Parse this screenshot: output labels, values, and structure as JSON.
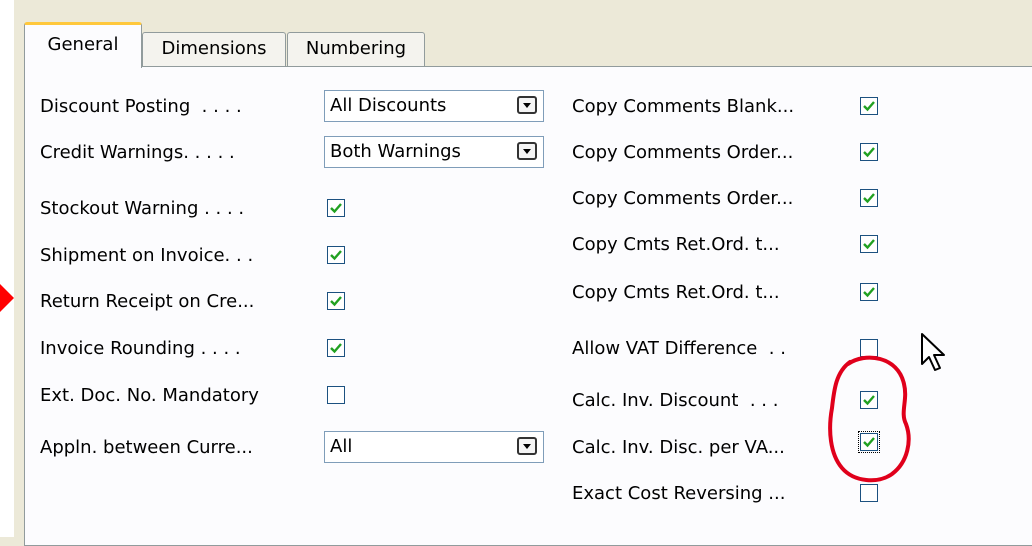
{
  "tabs": [
    "General",
    "Dimensions",
    "Numbering"
  ],
  "left": {
    "discount_posting": {
      "label": "Discount Posting  . . . .",
      "value": "All Discounts"
    },
    "credit_warnings": {
      "label": "Credit Warnings. . . . .",
      "value": "Both Warnings"
    },
    "stockout_warning": {
      "label": "Stockout Warning . . . .",
      "checked": true
    },
    "shipment_on_invoice": {
      "label": "Shipment on Invoice. . .",
      "checked": true
    },
    "return_receipt": {
      "label": "Return Receipt on Cre...",
      "checked": true
    },
    "invoice_rounding": {
      "label": "Invoice Rounding . . . .",
      "checked": true
    },
    "ext_doc_no": {
      "label": "Ext. Doc. No. Mandatory",
      "checked": false
    },
    "appln_between": {
      "label": "Appln. between Curre...",
      "value": "All"
    }
  },
  "right": {
    "copy_comments_blank": {
      "label": "Copy Comments Blank...",
      "checked": true
    },
    "copy_comments_order_1": {
      "label": "Copy Comments Order...",
      "checked": true
    },
    "copy_comments_order_2": {
      "label": "Copy Comments Order...",
      "checked": true
    },
    "copy_cmts_ret_1": {
      "label": "Copy Cmts Ret.Ord. t...",
      "checked": true
    },
    "copy_cmts_ret_2": {
      "label": "Copy Cmts Ret.Ord. t...",
      "checked": true
    },
    "allow_vat_difference": {
      "label": "Allow VAT Difference  . .",
      "checked": false
    },
    "calc_inv_discount": {
      "label": "Calc. Inv. Discount  . . .",
      "checked": true
    },
    "calc_inv_disc_per_vat": {
      "label": "Calc. Inv. Disc. per VA...",
      "checked": true
    },
    "exact_cost_reversing": {
      "label": "Exact Cost Reversing ...",
      "checked": false
    }
  },
  "colors": {
    "check": "#21a121",
    "annotation": "#e0001b",
    "arrow": "#ff0000"
  }
}
